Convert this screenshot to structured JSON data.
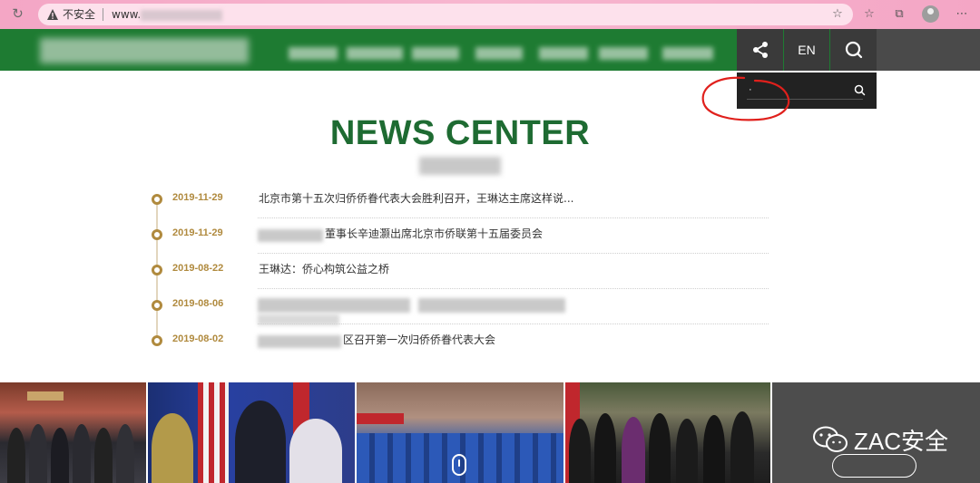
{
  "browser": {
    "security_label": "不安全",
    "url_prefix": "www."
  },
  "header": {
    "lang_label": "EN"
  },
  "search": {
    "value": "·"
  },
  "news": {
    "title": "NEWS CENTER",
    "items": [
      {
        "date": "2019-11-29",
        "title": "北京市第十五次归侨侨眷代表大会胜利召开，王琳达主席这样说..."
      },
      {
        "date": "2019-11-29",
        "title": "董事长辛迪灏出席北京市侨联第十五届委员会"
      },
      {
        "date": "2019-08-22",
        "title": "王琳达：侨心构筑公益之桥"
      },
      {
        "date": "2019-08-06",
        "title": ""
      },
      {
        "date": "2019-08-02",
        "title": "区召开第一次归侨侨眷代表大会"
      }
    ]
  },
  "watermark": {
    "text": "ZAC安全"
  },
  "colors": {
    "brand_green": "#1e7b32",
    "title_green": "#1e6b32",
    "accent_gold": "#b08a3e",
    "annotation_red": "#e0201c"
  }
}
